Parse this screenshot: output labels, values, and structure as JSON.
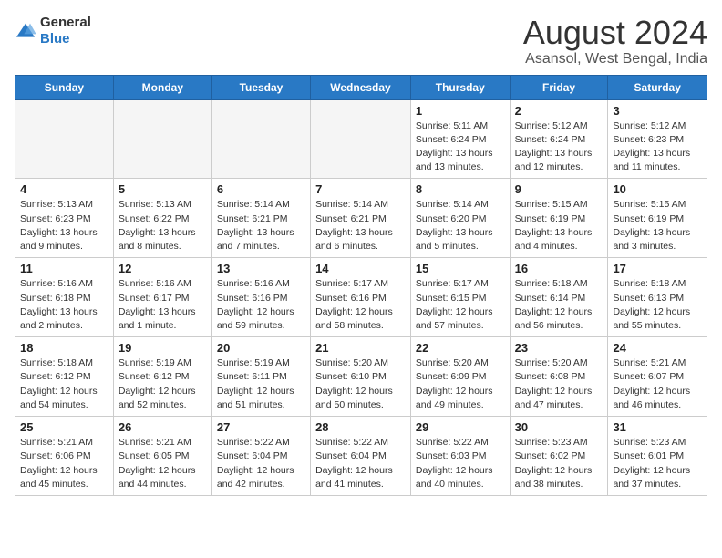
{
  "logo": {
    "text_general": "General",
    "text_blue": "Blue"
  },
  "header": {
    "month": "August 2024",
    "location": "Asansol, West Bengal, India"
  },
  "weekdays": [
    "Sunday",
    "Monday",
    "Tuesday",
    "Wednesday",
    "Thursday",
    "Friday",
    "Saturday"
  ],
  "weeks": [
    [
      {
        "day": "",
        "info": ""
      },
      {
        "day": "",
        "info": ""
      },
      {
        "day": "",
        "info": ""
      },
      {
        "day": "",
        "info": ""
      },
      {
        "day": "1",
        "info": "Sunrise: 5:11 AM\nSunset: 6:24 PM\nDaylight: 13 hours\nand 13 minutes."
      },
      {
        "day": "2",
        "info": "Sunrise: 5:12 AM\nSunset: 6:24 PM\nDaylight: 13 hours\nand 12 minutes."
      },
      {
        "day": "3",
        "info": "Sunrise: 5:12 AM\nSunset: 6:23 PM\nDaylight: 13 hours\nand 11 minutes."
      }
    ],
    [
      {
        "day": "4",
        "info": "Sunrise: 5:13 AM\nSunset: 6:23 PM\nDaylight: 13 hours\nand 9 minutes."
      },
      {
        "day": "5",
        "info": "Sunrise: 5:13 AM\nSunset: 6:22 PM\nDaylight: 13 hours\nand 8 minutes."
      },
      {
        "day": "6",
        "info": "Sunrise: 5:14 AM\nSunset: 6:21 PM\nDaylight: 13 hours\nand 7 minutes."
      },
      {
        "day": "7",
        "info": "Sunrise: 5:14 AM\nSunset: 6:21 PM\nDaylight: 13 hours\nand 6 minutes."
      },
      {
        "day": "8",
        "info": "Sunrise: 5:14 AM\nSunset: 6:20 PM\nDaylight: 13 hours\nand 5 minutes."
      },
      {
        "day": "9",
        "info": "Sunrise: 5:15 AM\nSunset: 6:19 PM\nDaylight: 13 hours\nand 4 minutes."
      },
      {
        "day": "10",
        "info": "Sunrise: 5:15 AM\nSunset: 6:19 PM\nDaylight: 13 hours\nand 3 minutes."
      }
    ],
    [
      {
        "day": "11",
        "info": "Sunrise: 5:16 AM\nSunset: 6:18 PM\nDaylight: 13 hours\nand 2 minutes."
      },
      {
        "day": "12",
        "info": "Sunrise: 5:16 AM\nSunset: 6:17 PM\nDaylight: 13 hours\nand 1 minute."
      },
      {
        "day": "13",
        "info": "Sunrise: 5:16 AM\nSunset: 6:16 PM\nDaylight: 12 hours\nand 59 minutes."
      },
      {
        "day": "14",
        "info": "Sunrise: 5:17 AM\nSunset: 6:16 PM\nDaylight: 12 hours\nand 58 minutes."
      },
      {
        "day": "15",
        "info": "Sunrise: 5:17 AM\nSunset: 6:15 PM\nDaylight: 12 hours\nand 57 minutes."
      },
      {
        "day": "16",
        "info": "Sunrise: 5:18 AM\nSunset: 6:14 PM\nDaylight: 12 hours\nand 56 minutes."
      },
      {
        "day": "17",
        "info": "Sunrise: 5:18 AM\nSunset: 6:13 PM\nDaylight: 12 hours\nand 55 minutes."
      }
    ],
    [
      {
        "day": "18",
        "info": "Sunrise: 5:18 AM\nSunset: 6:12 PM\nDaylight: 12 hours\nand 54 minutes."
      },
      {
        "day": "19",
        "info": "Sunrise: 5:19 AM\nSunset: 6:12 PM\nDaylight: 12 hours\nand 52 minutes."
      },
      {
        "day": "20",
        "info": "Sunrise: 5:19 AM\nSunset: 6:11 PM\nDaylight: 12 hours\nand 51 minutes."
      },
      {
        "day": "21",
        "info": "Sunrise: 5:20 AM\nSunset: 6:10 PM\nDaylight: 12 hours\nand 50 minutes."
      },
      {
        "day": "22",
        "info": "Sunrise: 5:20 AM\nSunset: 6:09 PM\nDaylight: 12 hours\nand 49 minutes."
      },
      {
        "day": "23",
        "info": "Sunrise: 5:20 AM\nSunset: 6:08 PM\nDaylight: 12 hours\nand 47 minutes."
      },
      {
        "day": "24",
        "info": "Sunrise: 5:21 AM\nSunset: 6:07 PM\nDaylight: 12 hours\nand 46 minutes."
      }
    ],
    [
      {
        "day": "25",
        "info": "Sunrise: 5:21 AM\nSunset: 6:06 PM\nDaylight: 12 hours\nand 45 minutes."
      },
      {
        "day": "26",
        "info": "Sunrise: 5:21 AM\nSunset: 6:05 PM\nDaylight: 12 hours\nand 44 minutes."
      },
      {
        "day": "27",
        "info": "Sunrise: 5:22 AM\nSunset: 6:04 PM\nDaylight: 12 hours\nand 42 minutes."
      },
      {
        "day": "28",
        "info": "Sunrise: 5:22 AM\nSunset: 6:04 PM\nDaylight: 12 hours\nand 41 minutes."
      },
      {
        "day": "29",
        "info": "Sunrise: 5:22 AM\nSunset: 6:03 PM\nDaylight: 12 hours\nand 40 minutes."
      },
      {
        "day": "30",
        "info": "Sunrise: 5:23 AM\nSunset: 6:02 PM\nDaylight: 12 hours\nand 38 minutes."
      },
      {
        "day": "31",
        "info": "Sunrise: 5:23 AM\nSunset: 6:01 PM\nDaylight: 12 hours\nand 37 minutes."
      }
    ]
  ]
}
